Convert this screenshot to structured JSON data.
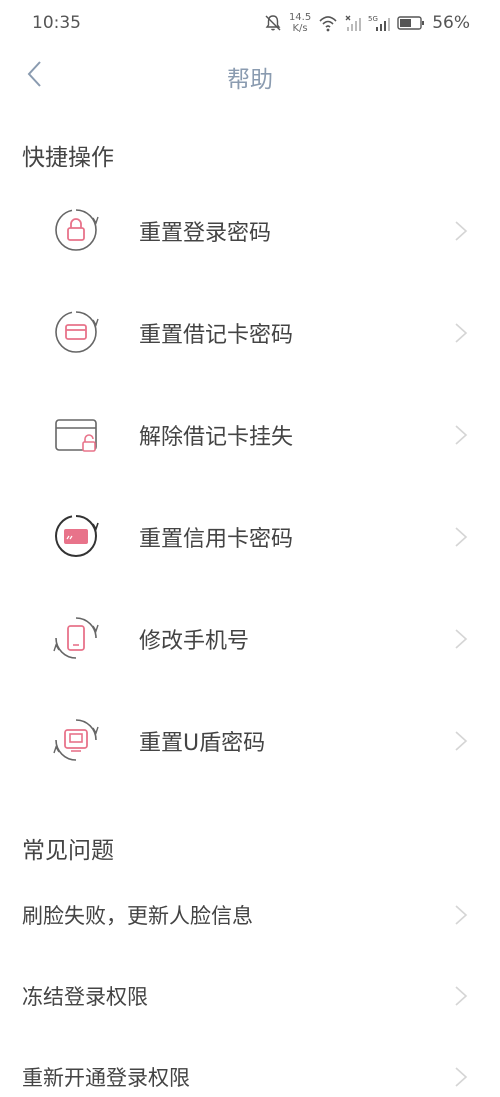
{
  "status": {
    "time": "10:35",
    "net_speed_value": "14.5",
    "net_speed_unit": "K/s",
    "battery": "56%"
  },
  "nav": {
    "title": "帮助"
  },
  "quick_actions": {
    "title": "快捷操作",
    "items": [
      {
        "label": "重置登录密码",
        "icon": "lock-reset-icon"
      },
      {
        "label": "重置借记卡密码",
        "icon": "card-reset-icon"
      },
      {
        "label": "解除借记卡挂失",
        "icon": "card-unlock-icon"
      },
      {
        "label": "重置信用卡密码",
        "icon": "credit-card-reset-icon"
      },
      {
        "label": "修改手机号",
        "icon": "phone-reset-icon"
      },
      {
        "label": "重置U盾密码",
        "icon": "ukey-reset-icon"
      }
    ]
  },
  "faq": {
    "title": "常见问题",
    "items": [
      {
        "label": "刷脸失败，更新人脸信息"
      },
      {
        "label": "冻结登录权限"
      },
      {
        "label": "重新开通登录权限"
      }
    ]
  },
  "colors": {
    "accent": "#e8738a",
    "ring": "#666666",
    "chevron": "#d5d5d5"
  }
}
